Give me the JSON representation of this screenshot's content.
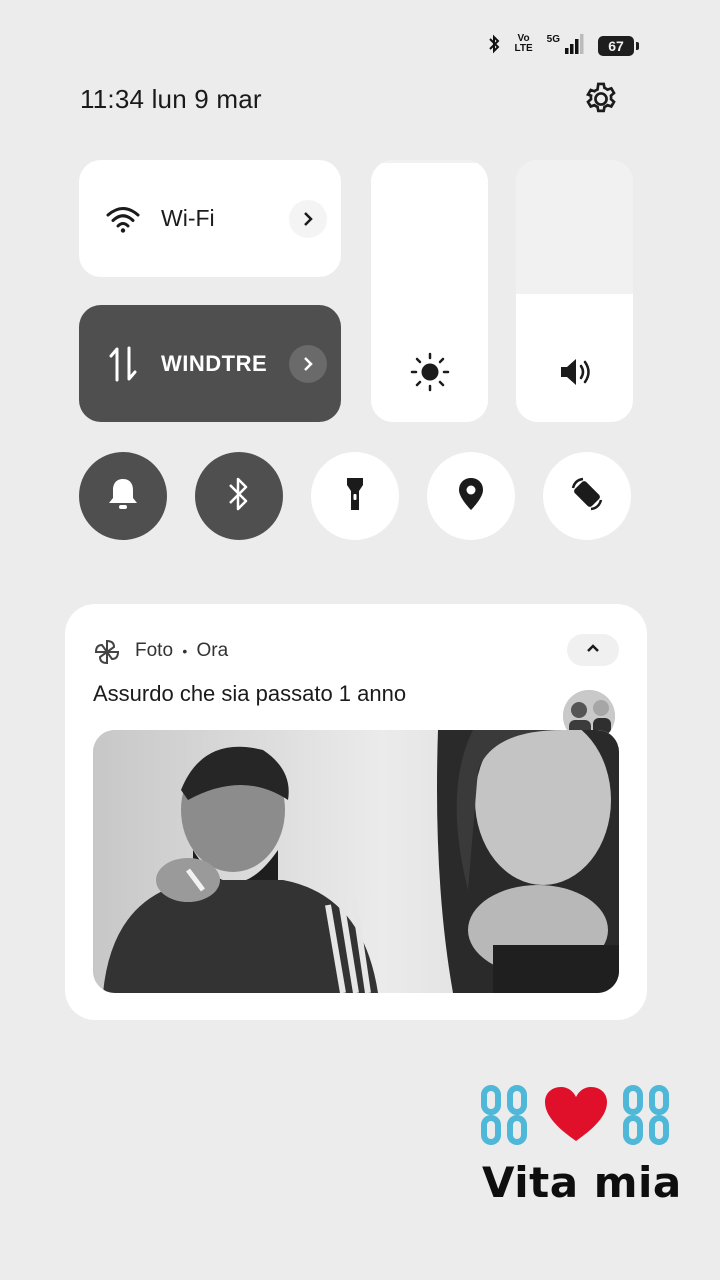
{
  "status_bar": {
    "volte_top": "Vo",
    "volte_bottom": "LTE",
    "network": "5G",
    "battery": "67",
    "icons": [
      "bluetooth-icon",
      "volte-icon",
      "signal-icon",
      "battery-icon"
    ]
  },
  "header": {
    "time": "11:34",
    "date": "lun 9 mar"
  },
  "quick_settings": {
    "wifi": {
      "label": "Wi-Fi",
      "icon": "wifi-icon"
    },
    "mobile_data": {
      "label": "WINDTRE",
      "icon": "mobile-data-icon",
      "active": true
    },
    "brightness": {
      "icon": "brightness-icon",
      "level": 0.99
    },
    "volume": {
      "icon": "volume-icon",
      "level": 0.49
    },
    "toggles": [
      {
        "name": "sound",
        "icon": "bell-icon",
        "active": true
      },
      {
        "name": "bluetooth",
        "icon": "bluetooth-icon",
        "active": true
      },
      {
        "name": "flashlight",
        "icon": "flashlight-icon",
        "active": false
      },
      {
        "name": "location",
        "icon": "location-icon",
        "active": false
      },
      {
        "name": "auto-rotate",
        "icon": "rotate-icon",
        "active": false
      }
    ]
  },
  "notification": {
    "app": "Foto",
    "separator": "•",
    "time": "Ora",
    "title": "Assurdo che sia passato 1 anno",
    "icon": "pinwheel-icon"
  },
  "sticker": {
    "text": "Vita mia",
    "icons": [
      "chain-icon",
      "heart-icon",
      "chain-icon"
    ]
  },
  "colors": {
    "background": "#ececec",
    "tile_active": "#4f4f4f",
    "tile_inactive": "#ffffff",
    "heart": "#e0102a",
    "chain": "#4fb7d8"
  }
}
